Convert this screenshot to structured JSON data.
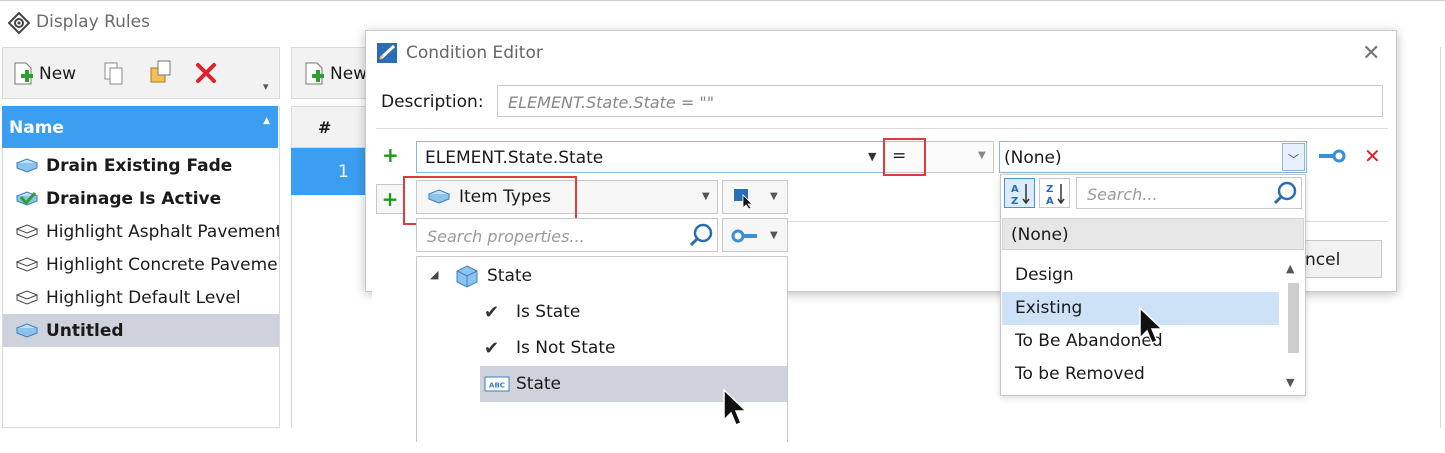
{
  "display_rules": {
    "title": "Display Rules",
    "toolbar": {
      "new_label": "New"
    },
    "list_header": "Name",
    "rules": [
      {
        "label": "Drain Existing Fade",
        "bold": true
      },
      {
        "label": "Drainage Is Active",
        "bold": true
      },
      {
        "label": "Highlight Asphalt Pavement",
        "bold": false
      },
      {
        "label": "Highlight Concrete Pavemen",
        "bold": false
      },
      {
        "label": "Highlight Default Level",
        "bold": false
      },
      {
        "label": "Untitled",
        "bold": true,
        "selected": true
      }
    ],
    "right_toolbar": {
      "new_label": "New"
    },
    "grid": {
      "col_hash": "#",
      "row_number": "1"
    }
  },
  "condition_editor": {
    "title": "Condition Editor",
    "description_label": "Description:",
    "description_value": "ELEMENT.State.State = \"\"",
    "property": "ELEMENT.State.State",
    "operator": "=",
    "value": "(None)",
    "cancel_label": "ncel"
  },
  "property_picker": {
    "type_selector": "Item Types",
    "search_placeholder": "Search properties...",
    "tree": {
      "root": "State",
      "children": [
        "Is State",
        "Is Not State",
        "State"
      ]
    }
  },
  "value_list": {
    "search_placeholder": "Search...",
    "none_option": "(None)",
    "options": [
      "Design",
      "Existing",
      "To Be Abandoned",
      "To be Removed"
    ],
    "selected": "Existing"
  },
  "colors": {
    "accent": "#3b9ef0",
    "highlight_box": "#e0393e",
    "add_green": "#1a9a1a",
    "delete_red": "#e0202a",
    "selection": "#cdd2dc"
  }
}
